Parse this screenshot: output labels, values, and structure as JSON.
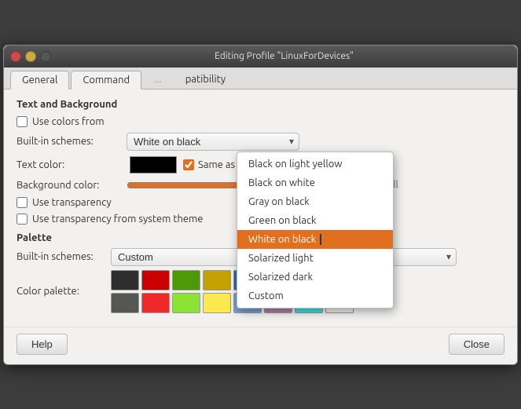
{
  "titlebar": {
    "title": "Editing Profile \"LinuxForDevices\""
  },
  "tabs": [
    {
      "label": "General",
      "active": false
    },
    {
      "label": "Command",
      "active": true
    },
    {
      "label": "...",
      "active": false
    },
    {
      "label": "patibility",
      "active": false
    }
  ],
  "text_background": {
    "section_title": "Text and Background",
    "use_colors_label": "Use colors from",
    "builtin_schemes_label": "Built-in schemes:",
    "selected_scheme": "White on black",
    "text_color_label": "Text color:",
    "bg_color_label": "Background color:",
    "use_transparency_label": "Use transparency",
    "use_system_theme_label": "Use transparency from system theme",
    "same_as_text_label": "Same as text color",
    "slider_label": "full"
  },
  "dropdown_menu": {
    "items": [
      {
        "label": "Black on light yellow",
        "selected": false
      },
      {
        "label": "Black on white",
        "selected": false
      },
      {
        "label": "Gray on black",
        "selected": false
      },
      {
        "label": "Green on black",
        "selected": false
      },
      {
        "label": "White on black",
        "selected": true
      },
      {
        "label": "Solarized light",
        "selected": false
      },
      {
        "label": "Solarized dark",
        "selected": false
      },
      {
        "label": "Custom",
        "selected": false
      }
    ]
  },
  "palette": {
    "section_title": "Palette",
    "builtin_label": "Built-in schemes:",
    "palette_label": "Color palette:",
    "selected_scheme": "Custom",
    "row1": [
      "#2e2e2e",
      "#cc0000",
      "#4e9a06",
      "#c4a000",
      "#3465a4",
      "#75507b",
      "#06989a",
      "#d3d7cf"
    ],
    "row2": [
      "#555753",
      "#ef2929",
      "#8ae234",
      "#fce94f",
      "#729fcf",
      "#ad7fa8",
      "#34e2e2",
      "#eeeeec"
    ]
  },
  "footer": {
    "help_label": "Help",
    "close_label": "Close"
  }
}
